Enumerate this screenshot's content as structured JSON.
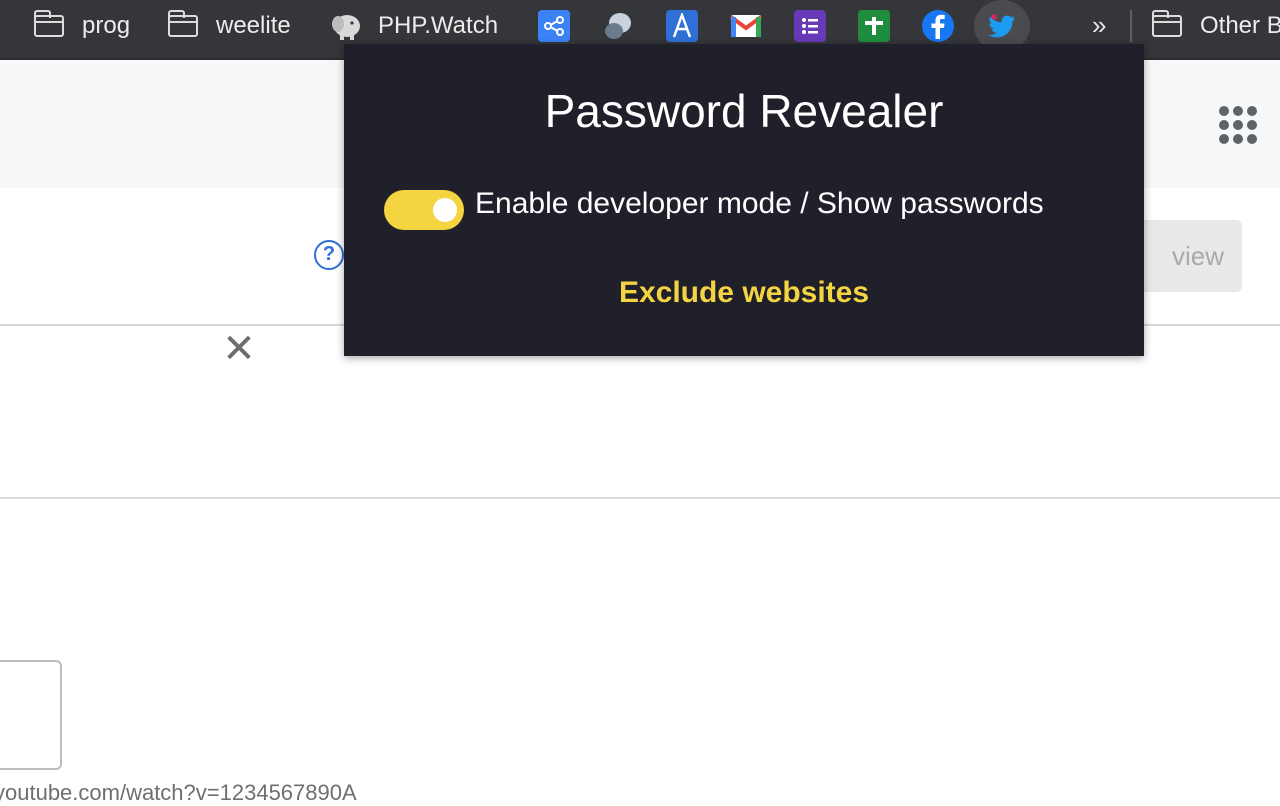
{
  "bookmarks_bar": {
    "items": [
      {
        "label": "prog",
        "icon": "folder-icon"
      },
      {
        "label": "weelite",
        "icon": "folder-icon"
      },
      {
        "label": "PHP.Watch",
        "icon": "elephant-icon"
      }
    ],
    "favicons": [
      "share-nodes-icon",
      "chat-bubbles-icon",
      "font-a-icon",
      "gmail-icon",
      "forms-list-icon",
      "sheets-plus-icon",
      "facebook-icon",
      "twitter-icon"
    ],
    "overflow_label": "»",
    "other_bookmarks_label": "Other B"
  },
  "page": {
    "preview_button_label": "view",
    "close_label": "✕",
    "help_label": "?",
    "url_snippet": "youtube.com/watch?v=1234567890A"
  },
  "popup": {
    "title": "Password Revealer",
    "toggle_label": "Enable developer mode / Show passwords",
    "toggle_on": true,
    "exclude_link": "Exclude websites",
    "accent_color": "#f5d442",
    "background_color": "#1f2029"
  }
}
